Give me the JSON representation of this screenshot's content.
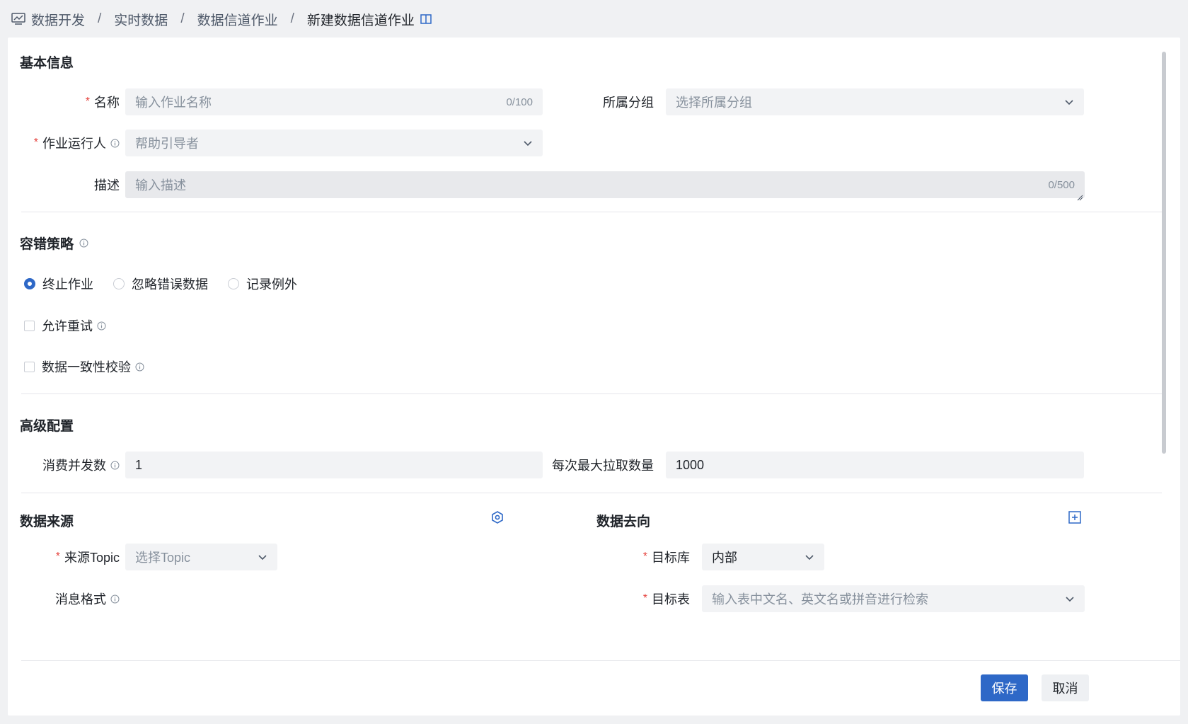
{
  "breadcrumb": {
    "items": [
      "数据开发",
      "实时数据",
      "数据信道作业",
      "新建数据信道作业"
    ],
    "separator": "/"
  },
  "basic": {
    "title": "基本信息",
    "name_label": "名称",
    "name_placeholder": "输入作业名称",
    "name_count": "0/100",
    "group_label": "所属分组",
    "group_placeholder": "选择所属分组",
    "runner_label": "作业运行人",
    "runner_placeholder": "帮助引导者",
    "desc_label": "描述",
    "desc_placeholder": "输入描述",
    "desc_count": "0/500"
  },
  "fault": {
    "title": "容错策略",
    "options": [
      "终止作业",
      "忽略错误数据",
      "记录例外"
    ],
    "selected": "终止作业",
    "allow_retry": "允许重试",
    "consistency_check": "数据一致性校验"
  },
  "advanced": {
    "title": "高级配置",
    "concurrency_label": "消费并发数",
    "concurrency_value": "1",
    "max_pull_label": "每次最大拉取数量",
    "max_pull_value": "1000"
  },
  "source": {
    "title": "数据来源",
    "topic_label": "来源Topic",
    "topic_placeholder": "选择Topic",
    "format_label": "消息格式"
  },
  "target": {
    "title": "数据去向",
    "db_label": "目标库",
    "db_value": "内部",
    "table_label": "目标表",
    "table_placeholder": "输入表中文名、英文名或拼音进行检索"
  },
  "footer": {
    "save": "保存",
    "cancel": "取消"
  },
  "colors": {
    "primary": "#2e68c7",
    "required": "#e5413c"
  }
}
